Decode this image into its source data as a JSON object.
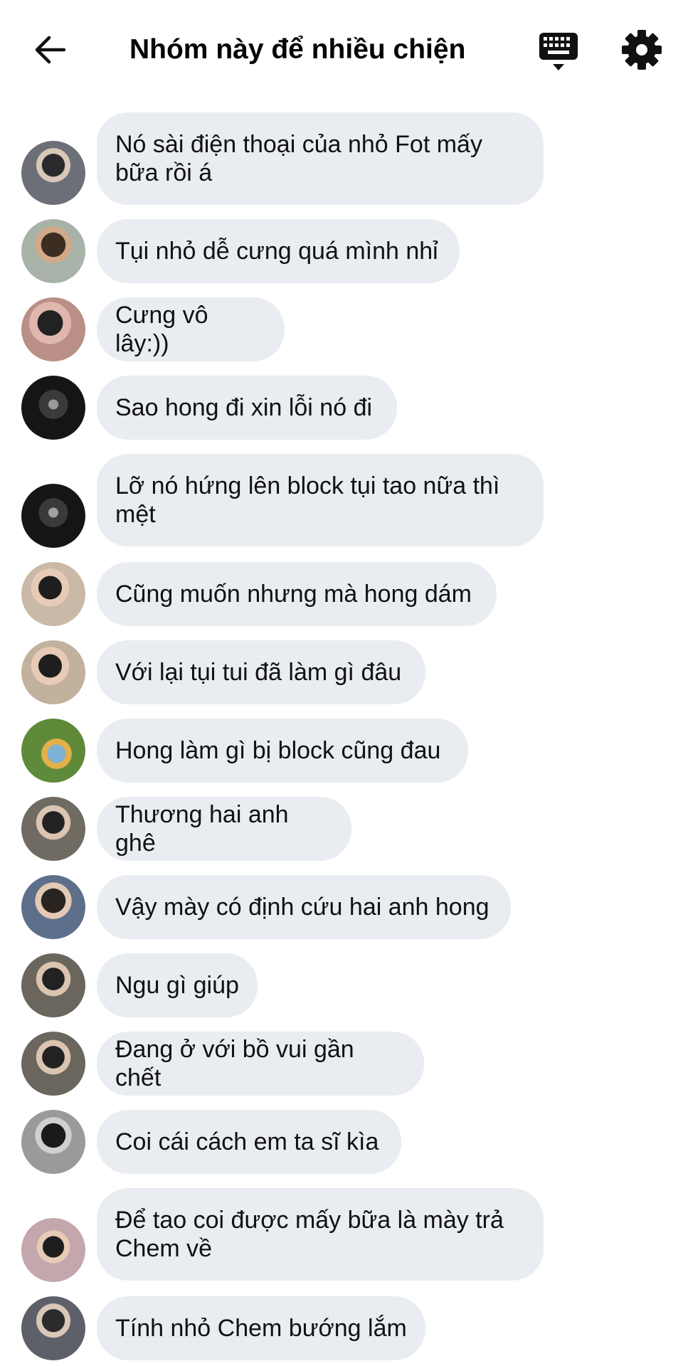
{
  "header": {
    "title": "Nhóm này để nhiều chiện",
    "back_icon": "arrow-left-icon",
    "keyboard_icon": "keyboard-icon",
    "settings_icon": "gear-icon"
  },
  "messages": [
    {
      "text": "Nó sài điện thoại của nhỏ Fot mấy bữa rồi á",
      "avatar_color": "#6d6f78"
    },
    {
      "text": "Tụi nhỏ dễ cưng quá mình nhỉ",
      "avatar_color": "#8a7a63"
    },
    {
      "text": "Cưng vô lây:))",
      "avatar_color": "#b98f86"
    },
    {
      "text": "Sao hong đi xin lỗi nó đi",
      "avatar_color": "#2a2a2a"
    },
    {
      "text": "Lỡ nó hứng lên block tụi tao nữa thì mệt",
      "avatar_color": "#2f2f2f"
    },
    {
      "text": "Cũng muốn nhưng mà hong dám",
      "avatar_color": "#c9b9a6"
    },
    {
      "text": "Với lại tụi tui đã làm gì đâu",
      "avatar_color": "#c2b19d"
    },
    {
      "text": "Hong làm gì bị block cũng đau",
      "avatar_color": "#7fa35a"
    },
    {
      "text": "Thương hai anh ghê",
      "avatar_color": "#6f6a62"
    },
    {
      "text": "Vậy mày có định cứu hai anh hong",
      "avatar_color": "#5d6f8a"
    },
    {
      "text": "Ngu gì giúp",
      "avatar_color": "#6a655d"
    },
    {
      "text": "Đang ở với bồ vui gần chết",
      "avatar_color": "#6b665e"
    },
    {
      "text": "Coi cái cách em ta sĩ kìa",
      "avatar_color": "#9a9a9a"
    },
    {
      "text": "Để tao coi được mấy bữa là mày trả Chem về",
      "avatar_color": "#c3a7ad"
    },
    {
      "text": "Tính nhỏ Chem bướng lắm",
      "avatar_color": "#5e6069"
    }
  ]
}
